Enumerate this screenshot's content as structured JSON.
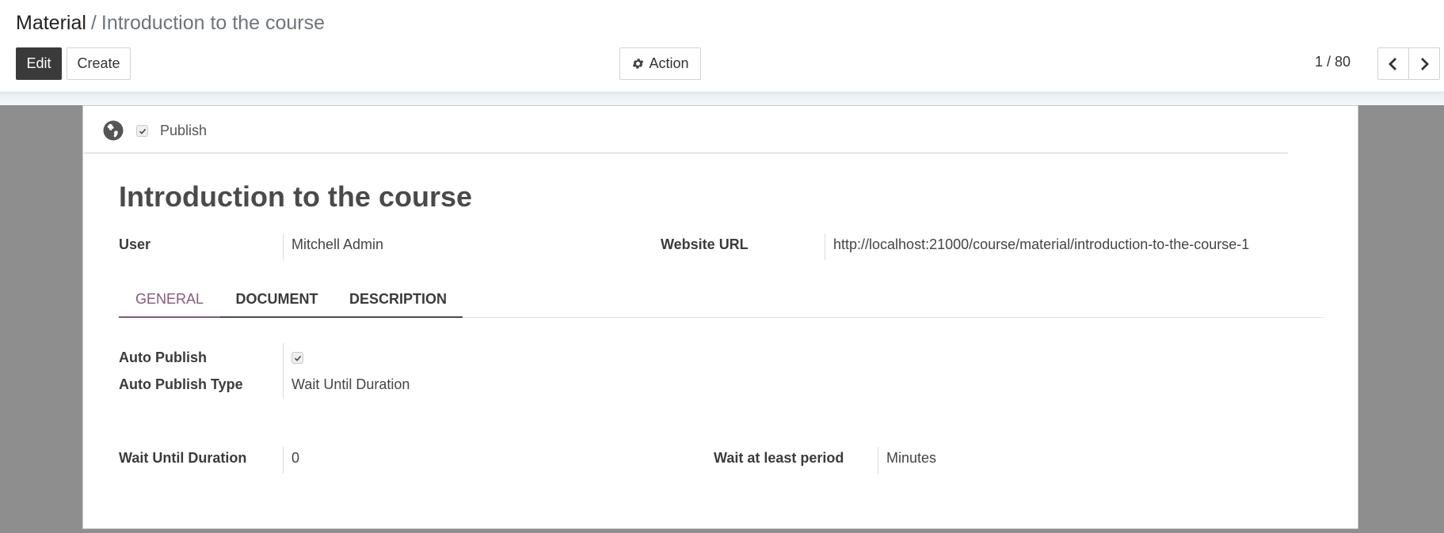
{
  "breadcrumb": {
    "root": "Material",
    "separator": "/",
    "current": "Introduction to the course"
  },
  "toolbar": {
    "edit_label": "Edit",
    "create_label": "Create",
    "action_label": "Action"
  },
  "pager": {
    "value": "1 / 80"
  },
  "publish": {
    "label": "Publish",
    "checked": true
  },
  "record": {
    "title": "Introduction to the course",
    "user_label": "User",
    "user_value": "Mitchell Admin",
    "url_label": "Website URL",
    "url_value": "http://localhost:21000/course/material/introduction-to-the-course-1"
  },
  "tabs": [
    {
      "label": "GENERAL",
      "active": true
    },
    {
      "label": "DOCUMENT",
      "active": false
    },
    {
      "label": "DESCRIPTION",
      "active": false
    }
  ],
  "general": {
    "auto_publish_label": "Auto Publish",
    "auto_publish_checked": true,
    "auto_publish_type_label": "Auto Publish Type",
    "auto_publish_type_value": "Wait Until Duration",
    "wait_duration_label": "Wait Until Duration",
    "wait_duration_value": "0",
    "wait_period_label": "Wait at least period",
    "wait_period_value": "Minutes"
  },
  "colors": {
    "accent": "#875a7b",
    "edit_button": "#3a3a3a",
    "background": "#8e8e8e"
  },
  "icons": {
    "action": "gear-icon",
    "publish": "globe-icon",
    "pager_prev": "chevron-left-icon",
    "pager_next": "chevron-right-icon"
  }
}
